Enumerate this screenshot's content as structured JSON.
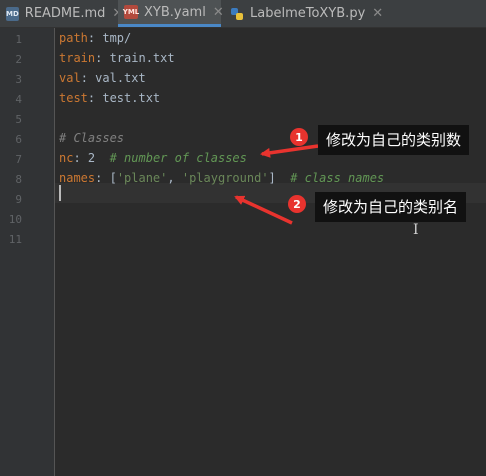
{
  "tabs": [
    {
      "label": "README.md",
      "icon": "markdown-file-icon",
      "icon_text": "MD",
      "active": false
    },
    {
      "label": "XYB.yaml",
      "icon": "yaml-file-icon",
      "icon_text": "YML",
      "active": true
    },
    {
      "label": "LabelmeToXYB.py",
      "icon": "python-file-icon",
      "active": false
    }
  ],
  "gutter": {
    "line_numbers": [
      "1",
      "2",
      "3",
      "4",
      "5",
      "6",
      "7",
      "8",
      "9",
      "10",
      "11"
    ]
  },
  "editor": {
    "line1": {
      "key": "path",
      "sep": ": ",
      "value": "tmp/"
    },
    "line2": {
      "key": "train",
      "sep": ": ",
      "value": "train.txt"
    },
    "line3": {
      "key": "val",
      "sep": ": ",
      "value": "val.txt"
    },
    "line4": {
      "key": "test",
      "sep": ": ",
      "value": "test.txt"
    },
    "line6": {
      "comment": "# Classes"
    },
    "line7": {
      "key": "nc",
      "sep": ": ",
      "value": "2",
      "comment": "# number of classes"
    },
    "line8": {
      "key": "names",
      "sep": ": ",
      "open": "[",
      "item1": "'plane'",
      "comma": ", ",
      "item2": "'playground'",
      "close": "]",
      "comment": "# class names"
    }
  },
  "annotations": {
    "badge1": "1",
    "callout1": "修改为自己的类别数",
    "badge2": "2",
    "callout2": "修改为自己的类别名",
    "accent_color": "#e8332e"
  },
  "colors": {
    "background": "#2b2b2b",
    "keyword": "#cc7832",
    "string": "#6a8759",
    "comment": "#629755",
    "text": "#a9b7c6"
  }
}
